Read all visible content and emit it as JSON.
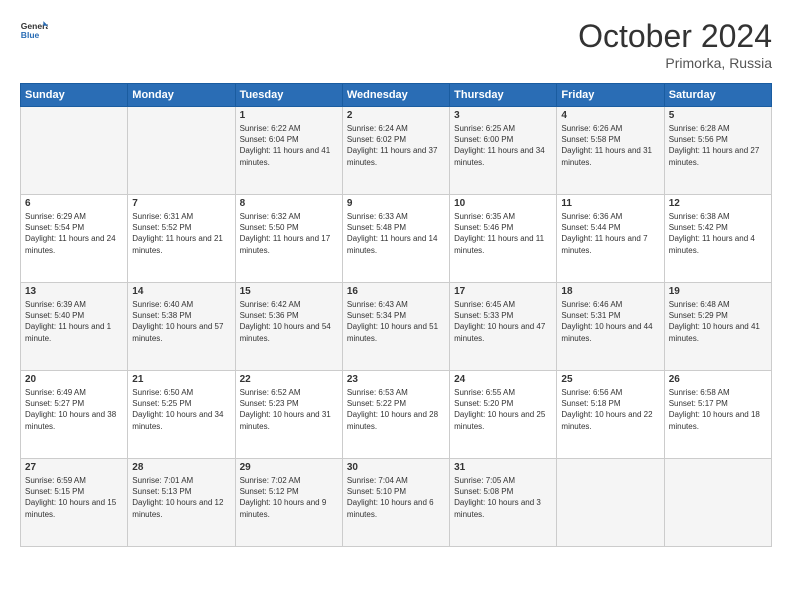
{
  "header": {
    "logo_general": "General",
    "logo_blue": "Blue",
    "month_title": "October 2024",
    "location": "Primorka, Russia"
  },
  "days_of_week": [
    "Sunday",
    "Monday",
    "Tuesday",
    "Wednesday",
    "Thursday",
    "Friday",
    "Saturday"
  ],
  "weeks": [
    [
      {
        "day": "",
        "sunrise": "",
        "sunset": "",
        "daylight": ""
      },
      {
        "day": "",
        "sunrise": "",
        "sunset": "",
        "daylight": ""
      },
      {
        "day": "1",
        "sunrise": "Sunrise: 6:22 AM",
        "sunset": "Sunset: 6:04 PM",
        "daylight": "Daylight: 11 hours and 41 minutes."
      },
      {
        "day": "2",
        "sunrise": "Sunrise: 6:24 AM",
        "sunset": "Sunset: 6:02 PM",
        "daylight": "Daylight: 11 hours and 37 minutes."
      },
      {
        "day": "3",
        "sunrise": "Sunrise: 6:25 AM",
        "sunset": "Sunset: 6:00 PM",
        "daylight": "Daylight: 11 hours and 34 minutes."
      },
      {
        "day": "4",
        "sunrise": "Sunrise: 6:26 AM",
        "sunset": "Sunset: 5:58 PM",
        "daylight": "Daylight: 11 hours and 31 minutes."
      },
      {
        "day": "5",
        "sunrise": "Sunrise: 6:28 AM",
        "sunset": "Sunset: 5:56 PM",
        "daylight": "Daylight: 11 hours and 27 minutes."
      }
    ],
    [
      {
        "day": "6",
        "sunrise": "Sunrise: 6:29 AM",
        "sunset": "Sunset: 5:54 PM",
        "daylight": "Daylight: 11 hours and 24 minutes."
      },
      {
        "day": "7",
        "sunrise": "Sunrise: 6:31 AM",
        "sunset": "Sunset: 5:52 PM",
        "daylight": "Daylight: 11 hours and 21 minutes."
      },
      {
        "day": "8",
        "sunrise": "Sunrise: 6:32 AM",
        "sunset": "Sunset: 5:50 PM",
        "daylight": "Daylight: 11 hours and 17 minutes."
      },
      {
        "day": "9",
        "sunrise": "Sunrise: 6:33 AM",
        "sunset": "Sunset: 5:48 PM",
        "daylight": "Daylight: 11 hours and 14 minutes."
      },
      {
        "day": "10",
        "sunrise": "Sunrise: 6:35 AM",
        "sunset": "Sunset: 5:46 PM",
        "daylight": "Daylight: 11 hours and 11 minutes."
      },
      {
        "day": "11",
        "sunrise": "Sunrise: 6:36 AM",
        "sunset": "Sunset: 5:44 PM",
        "daylight": "Daylight: 11 hours and 7 minutes."
      },
      {
        "day": "12",
        "sunrise": "Sunrise: 6:38 AM",
        "sunset": "Sunset: 5:42 PM",
        "daylight": "Daylight: 11 hours and 4 minutes."
      }
    ],
    [
      {
        "day": "13",
        "sunrise": "Sunrise: 6:39 AM",
        "sunset": "Sunset: 5:40 PM",
        "daylight": "Daylight: 11 hours and 1 minute."
      },
      {
        "day": "14",
        "sunrise": "Sunrise: 6:40 AM",
        "sunset": "Sunset: 5:38 PM",
        "daylight": "Daylight: 10 hours and 57 minutes."
      },
      {
        "day": "15",
        "sunrise": "Sunrise: 6:42 AM",
        "sunset": "Sunset: 5:36 PM",
        "daylight": "Daylight: 10 hours and 54 minutes."
      },
      {
        "day": "16",
        "sunrise": "Sunrise: 6:43 AM",
        "sunset": "Sunset: 5:34 PM",
        "daylight": "Daylight: 10 hours and 51 minutes."
      },
      {
        "day": "17",
        "sunrise": "Sunrise: 6:45 AM",
        "sunset": "Sunset: 5:33 PM",
        "daylight": "Daylight: 10 hours and 47 minutes."
      },
      {
        "day": "18",
        "sunrise": "Sunrise: 6:46 AM",
        "sunset": "Sunset: 5:31 PM",
        "daylight": "Daylight: 10 hours and 44 minutes."
      },
      {
        "day": "19",
        "sunrise": "Sunrise: 6:48 AM",
        "sunset": "Sunset: 5:29 PM",
        "daylight": "Daylight: 10 hours and 41 minutes."
      }
    ],
    [
      {
        "day": "20",
        "sunrise": "Sunrise: 6:49 AM",
        "sunset": "Sunset: 5:27 PM",
        "daylight": "Daylight: 10 hours and 38 minutes."
      },
      {
        "day": "21",
        "sunrise": "Sunrise: 6:50 AM",
        "sunset": "Sunset: 5:25 PM",
        "daylight": "Daylight: 10 hours and 34 minutes."
      },
      {
        "day": "22",
        "sunrise": "Sunrise: 6:52 AM",
        "sunset": "Sunset: 5:23 PM",
        "daylight": "Daylight: 10 hours and 31 minutes."
      },
      {
        "day": "23",
        "sunrise": "Sunrise: 6:53 AM",
        "sunset": "Sunset: 5:22 PM",
        "daylight": "Daylight: 10 hours and 28 minutes."
      },
      {
        "day": "24",
        "sunrise": "Sunrise: 6:55 AM",
        "sunset": "Sunset: 5:20 PM",
        "daylight": "Daylight: 10 hours and 25 minutes."
      },
      {
        "day": "25",
        "sunrise": "Sunrise: 6:56 AM",
        "sunset": "Sunset: 5:18 PM",
        "daylight": "Daylight: 10 hours and 22 minutes."
      },
      {
        "day": "26",
        "sunrise": "Sunrise: 6:58 AM",
        "sunset": "Sunset: 5:17 PM",
        "daylight": "Daylight: 10 hours and 18 minutes."
      }
    ],
    [
      {
        "day": "27",
        "sunrise": "Sunrise: 6:59 AM",
        "sunset": "Sunset: 5:15 PM",
        "daylight": "Daylight: 10 hours and 15 minutes."
      },
      {
        "day": "28",
        "sunrise": "Sunrise: 7:01 AM",
        "sunset": "Sunset: 5:13 PM",
        "daylight": "Daylight: 10 hours and 12 minutes."
      },
      {
        "day": "29",
        "sunrise": "Sunrise: 7:02 AM",
        "sunset": "Sunset: 5:12 PM",
        "daylight": "Daylight: 10 hours and 9 minutes."
      },
      {
        "day": "30",
        "sunrise": "Sunrise: 7:04 AM",
        "sunset": "Sunset: 5:10 PM",
        "daylight": "Daylight: 10 hours and 6 minutes."
      },
      {
        "day": "31",
        "sunrise": "Sunrise: 7:05 AM",
        "sunset": "Sunset: 5:08 PM",
        "daylight": "Daylight: 10 hours and 3 minutes."
      },
      {
        "day": "",
        "sunrise": "",
        "sunset": "",
        "daylight": ""
      },
      {
        "day": "",
        "sunrise": "",
        "sunset": "",
        "daylight": ""
      }
    ]
  ]
}
